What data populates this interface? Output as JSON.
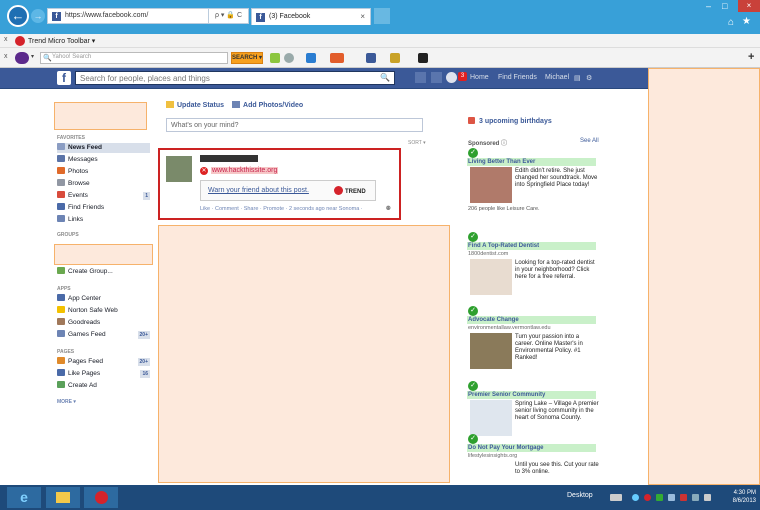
{
  "browser": {
    "url": "https://www.facebook.com/",
    "address_controls": "ρ ▾ 🔒 C",
    "tab_title": "(3) Facebook",
    "tab_close": "×",
    "back": "←",
    "forward": "→",
    "home": "⌂",
    "favorites": "★",
    "minimize": "–",
    "maximize": "□",
    "close": "×"
  },
  "trend_toolbar": {
    "close": "x",
    "label": "Trend Micro Toolbar ▾"
  },
  "yahoo_toolbar": {
    "close": "x",
    "search_placeholder": "Yahoo! Search",
    "search_button": "SEARCH ▾",
    "plus": "+"
  },
  "fb_header": {
    "logo": "f",
    "search_placeholder": "Search for people, places and things",
    "search_icon": "🔍",
    "notifications_count": "3",
    "nav_home": "Home",
    "nav_find_friends": "Find Friends",
    "nav_user": "Michael"
  },
  "sidebar": {
    "favorites_head": "FAVORITES",
    "favorites": [
      {
        "label": "News Feed",
        "color": "#8b9dc3",
        "count": ""
      },
      {
        "label": "Messages",
        "color": "#5b74a8",
        "count": ""
      },
      {
        "label": "Photos",
        "color": "#e06a2a",
        "count": ""
      },
      {
        "label": "Browse",
        "color": "#9197a3",
        "count": ""
      },
      {
        "label": "Events",
        "color": "#d84b3c",
        "count": "1"
      },
      {
        "label": "Find Friends",
        "color": "#4a6aa8",
        "count": ""
      },
      {
        "label": "Links",
        "color": "#6d84b4",
        "count": ""
      }
    ],
    "groups_head": "GROUPS",
    "create_group": "Create Group...",
    "apps_head": "APPS",
    "apps": [
      {
        "label": "App Center",
        "color": "#4a6aa8",
        "count": ""
      },
      {
        "label": "Norton Safe Web",
        "color": "#f3c100",
        "count": ""
      },
      {
        "label": "Goodreads",
        "color": "#a0785a",
        "count": ""
      },
      {
        "label": "Games Feed",
        "color": "#6d84b4",
        "count": "20+"
      }
    ],
    "pages_head": "PAGES",
    "pages": [
      {
        "label": "Pages Feed",
        "color": "#e08a2a",
        "count": "20+"
      },
      {
        "label": "Like Pages",
        "color": "#4a6aa8",
        "count": "16"
      },
      {
        "label": "Create Ad",
        "color": "#5aa05a",
        "count": ""
      }
    ],
    "more": "MORE ▾"
  },
  "composer": {
    "update_status": "Update Status",
    "add_photos": "Add Photos/Video",
    "placeholder": "What's on your mind?",
    "sort": "SORT ▾"
  },
  "post": {
    "link": "www.hackthissite.org",
    "warning_text": "Warn your friend about this post.",
    "warning_icon": "✕",
    "trend_logo": "TREND",
    "actions": "Like · Comment · Share · Promote · 2 seconds ago near Sonoma ·"
  },
  "right_col": {
    "birthdays": "3 upcoming birthdays",
    "sponsored": "Sponsored",
    "see_all": "See All",
    "ads": [
      {
        "title": "Living Better Than Ever",
        "domain": "",
        "text": "Edith didn't retire. She just changed her soundtrack. Move into Springfield Place today!",
        "social": "206 people like Leisure Care.",
        "img": "#b07a6a"
      },
      {
        "title": "Find A Top-Rated Dentist",
        "domain": "1800dentist.com",
        "text": "Looking for a top-rated dentist in your neighborhood? Click here for a free referral.",
        "social": "",
        "img": "#e8dcd0"
      },
      {
        "title": "Advocate Change",
        "domain": "environmentallaw.vermontlaw.edu",
        "text": "Turn your passion into a career. Online Master's in Environmental Policy. #1 Ranked!",
        "social": "",
        "img": "#8a7a5a"
      },
      {
        "title": "Premier Senior Community",
        "domain": "",
        "text": "Spring Lake – Village A premier senior living community in the heart of Sonoma County.",
        "social": "",
        "img": "#dfe6ee"
      },
      {
        "title": "Do Not Pay Your Mortgage",
        "domain": "lifestylesinsights.org",
        "text": "Until you see this. Cut your rate to 3% online.",
        "social": "",
        "img": "#ffffff"
      }
    ]
  },
  "taskbar": {
    "ie": "e",
    "desktop": "Desktop",
    "time": "4:30 PM",
    "date": "8/6/2013"
  }
}
